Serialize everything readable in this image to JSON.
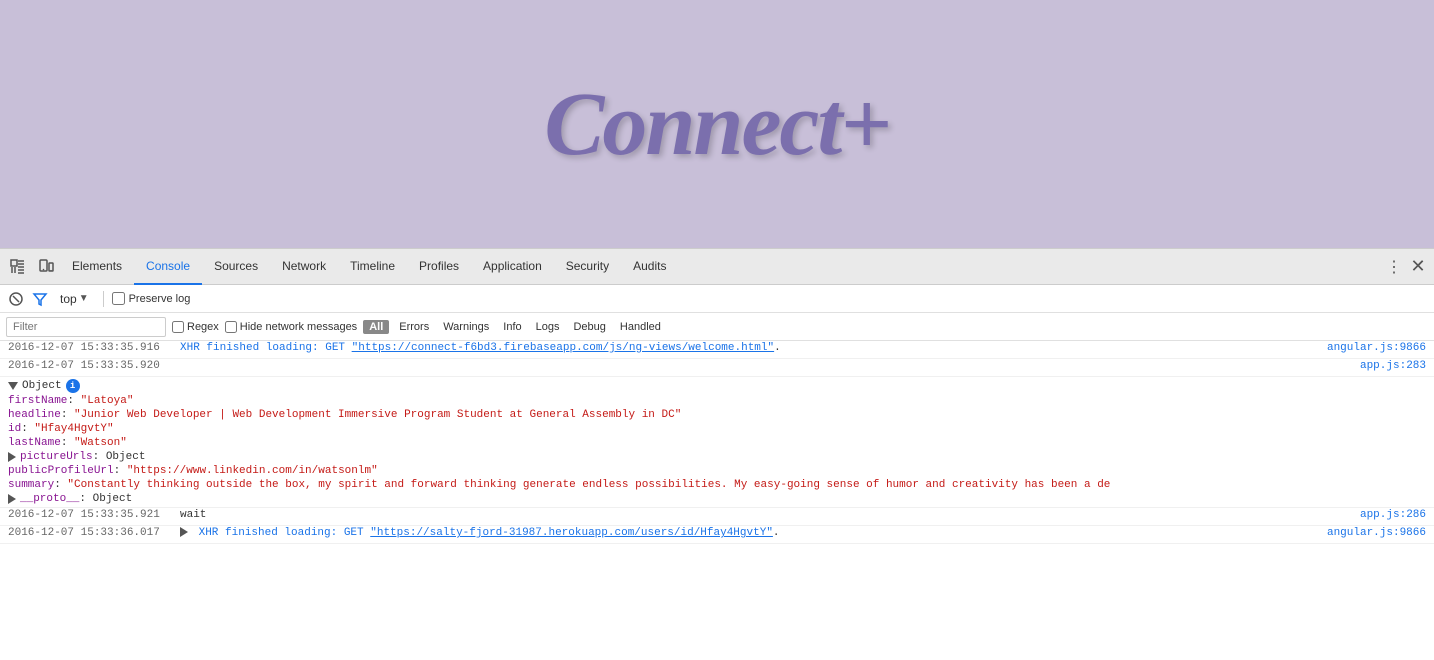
{
  "app": {
    "title": "Connect+",
    "background_color": "#c8bfd8"
  },
  "devtools": {
    "tabs": [
      {
        "id": "elements",
        "label": "Elements",
        "active": false
      },
      {
        "id": "console",
        "label": "Console",
        "active": true
      },
      {
        "id": "sources",
        "label": "Sources",
        "active": false
      },
      {
        "id": "network",
        "label": "Network",
        "active": false
      },
      {
        "id": "timeline",
        "label": "Timeline",
        "active": false
      },
      {
        "id": "profiles",
        "label": "Profiles",
        "active": false
      },
      {
        "id": "application",
        "label": "Application",
        "active": false
      },
      {
        "id": "security",
        "label": "Security",
        "active": false
      },
      {
        "id": "audits",
        "label": "Audits",
        "active": false
      }
    ]
  },
  "console": {
    "filter_text": "Filter",
    "filter_placeholder": "Filter",
    "top_label": "top",
    "preserve_log_label": "Preserve log",
    "levels": {
      "all_label": "All",
      "errors_label": "Errors",
      "warnings_label": "Warnings",
      "info_label": "Info",
      "logs_label": "Logs",
      "debug_label": "Debug",
      "handled_label": "Handled"
    },
    "log_entries": [
      {
        "id": 1,
        "timestamp": "2016-12-07 15:33:35.916",
        "type": "xhr",
        "content": "XHR finished loading: GET \"https://connect-f6bd3.firebaseapp.com/js/ng-views/welcome.html\".",
        "source": "angular.js:9866"
      },
      {
        "id": 2,
        "timestamp": "2016-12-07 15:33:35.920",
        "type": "normal",
        "content": "",
        "source": "app.js:283"
      },
      {
        "id": 3,
        "timestamp": "",
        "type": "object-expanded",
        "content": "▼ Object",
        "source": "",
        "fields": [
          {
            "key": "firstName",
            "value": "\"Latoya\"",
            "indent": 1
          },
          {
            "key": "headline",
            "value": "\"Junior Web Developer | Web Development Immersive Program Student at General Assembly in DC\"",
            "indent": 1
          },
          {
            "key": "id",
            "value": "\"Hfay4HgvtY\"",
            "indent": 1
          },
          {
            "key": "lastName",
            "value": "\"Watson\"",
            "indent": 1
          },
          {
            "key": "pictureUrls",
            "value": "Object",
            "indent": 1,
            "collapsed": true
          },
          {
            "key": "publicProfileUrl",
            "value": "\"https://www.linkedin.com/in/watsonlm\"",
            "indent": 1
          },
          {
            "key": "summary",
            "value": "\"Constantly thinking outside the box, my spirit and forward thinking generate endless possibilities. My easy-going sense of humor and creativity has been a de",
            "indent": 1
          },
          {
            "key": "__proto__",
            "value": "Object",
            "indent": 1,
            "collapsed": true
          }
        ]
      },
      {
        "id": 4,
        "timestamp": "2016-12-07 15:33:35.921",
        "type": "wait",
        "content": "wait",
        "source": "app.js:286"
      },
      {
        "id": 5,
        "timestamp": "2016-12-07 15:33:36.017",
        "type": "xhr",
        "content": "▶ XHR finished loading: GET \"https://salty-fjord-31987.herokuapp.com/users/id/Hfay4HgvtY\".",
        "source": "angular.js:9866"
      }
    ]
  }
}
